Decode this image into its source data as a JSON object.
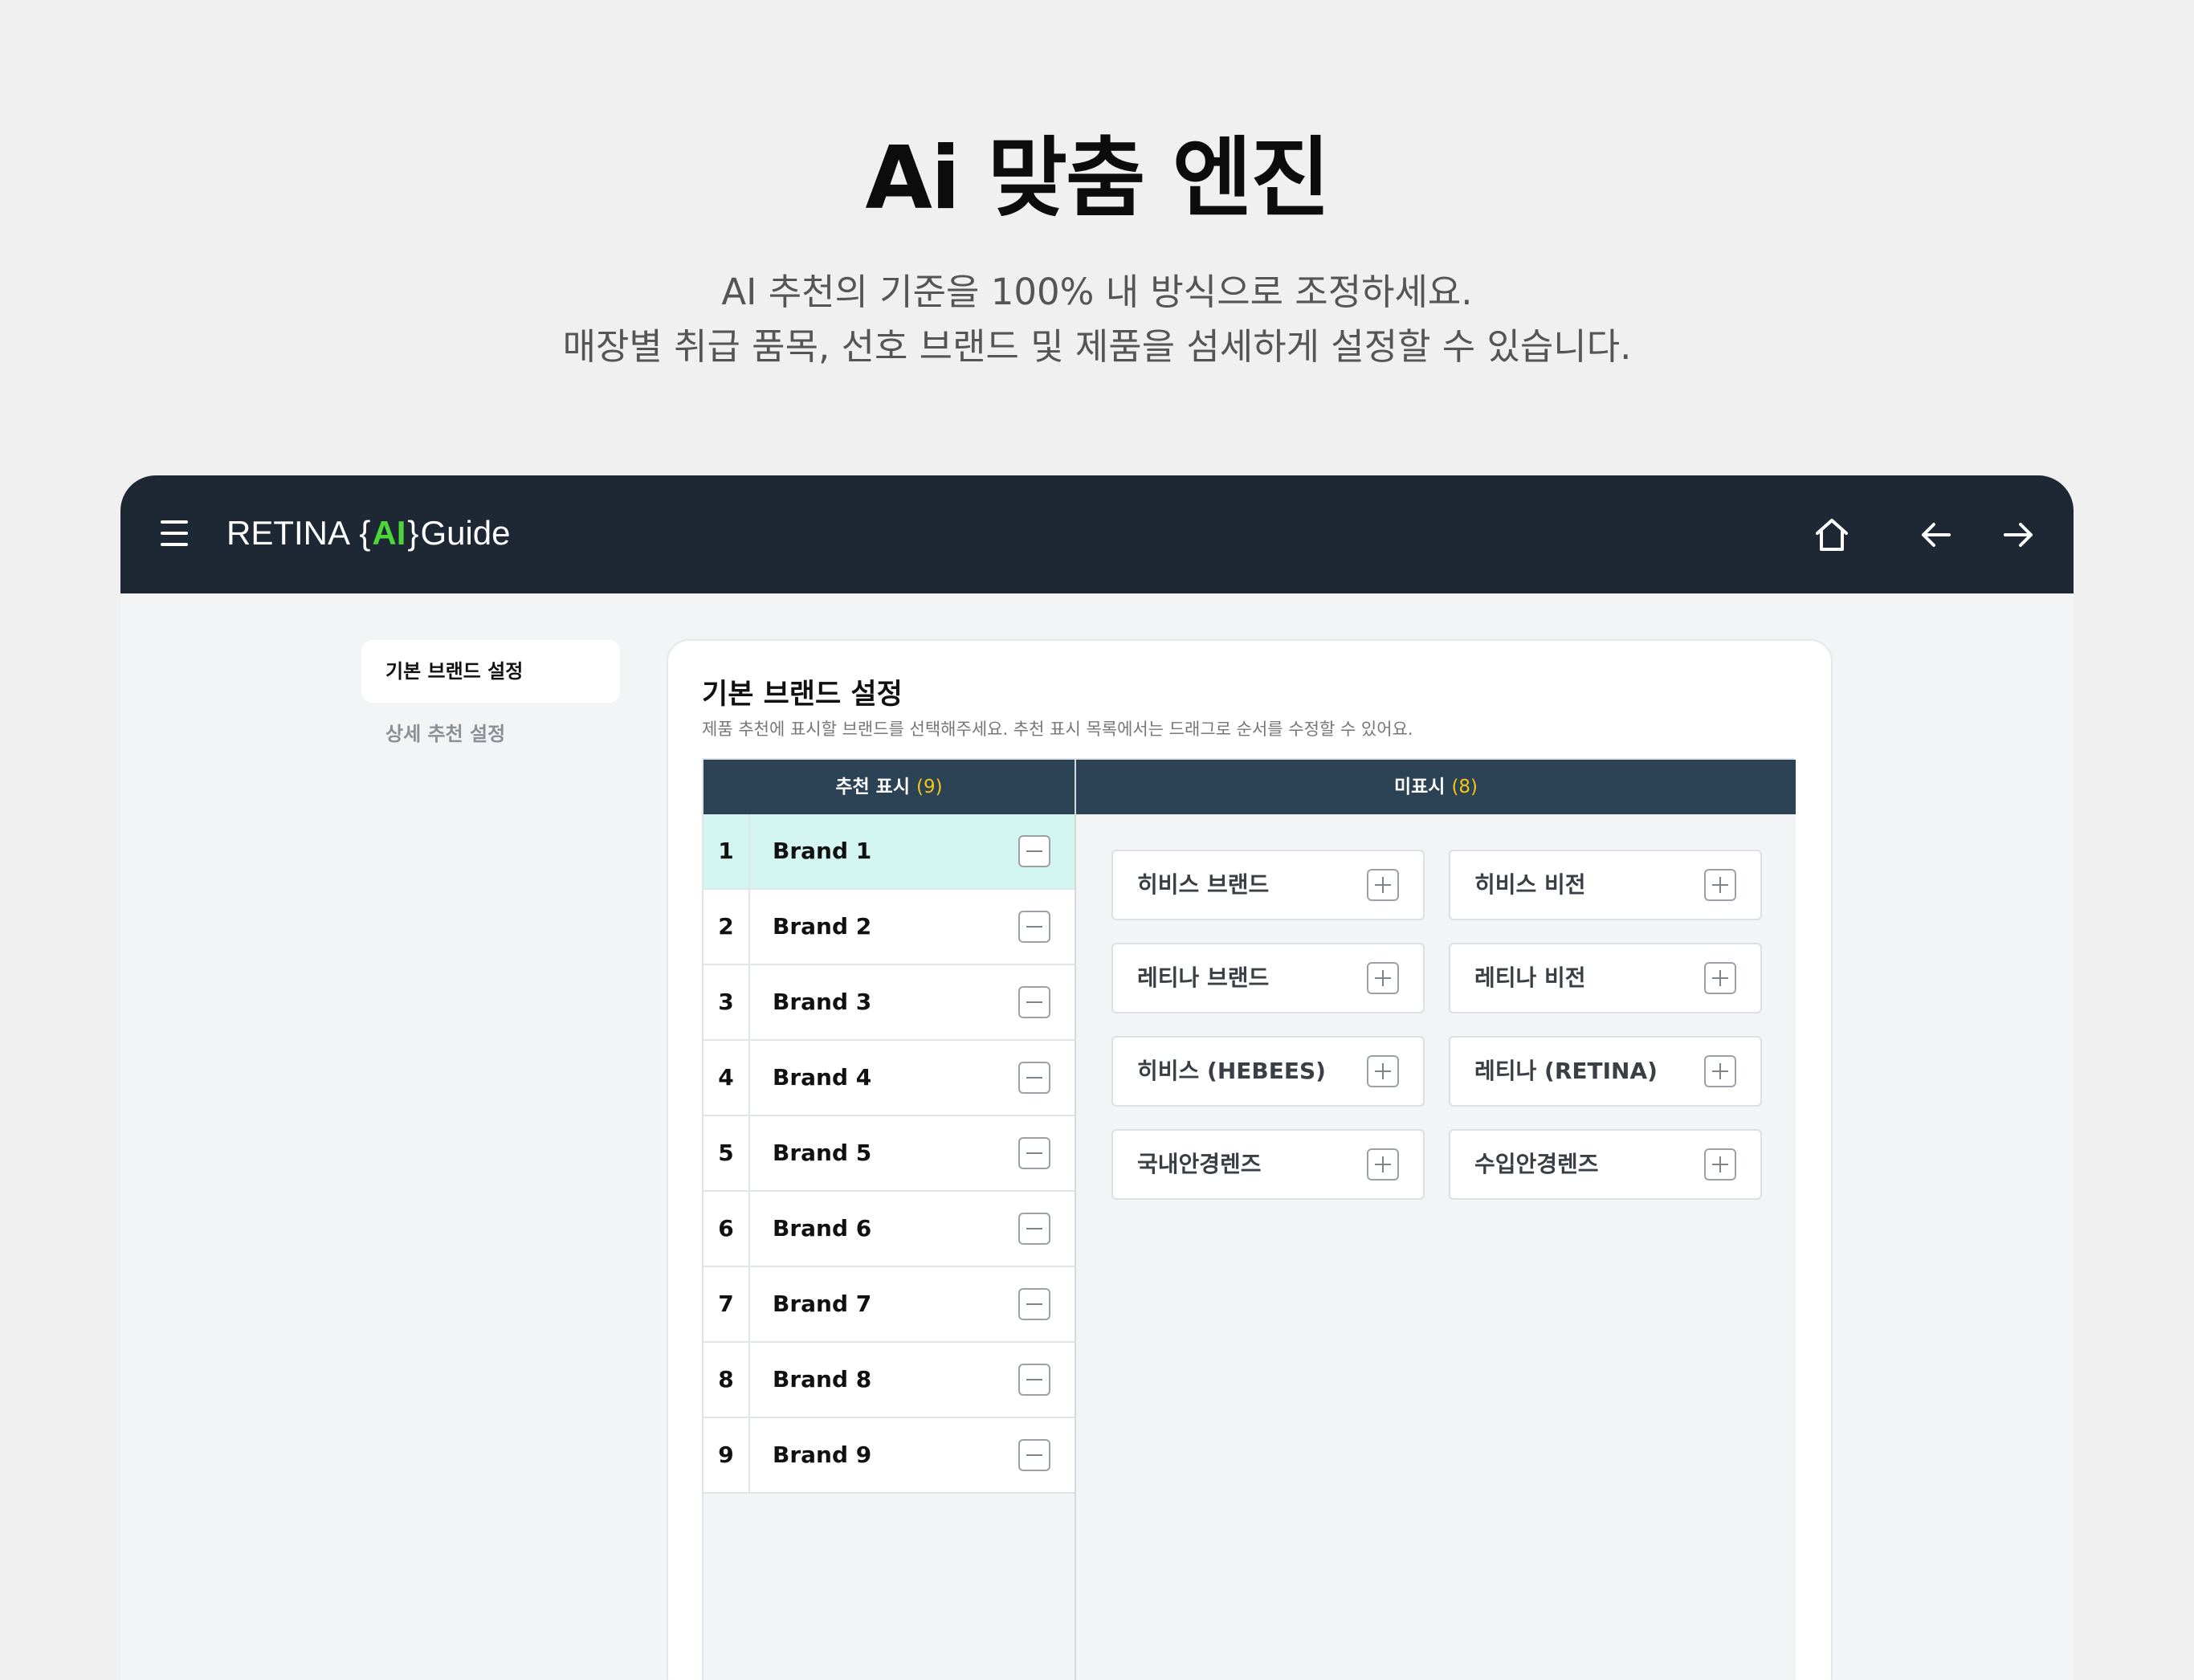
{
  "hero": {
    "title": "Ai 맞춤 엔진",
    "subtitle_line1": "AI 추천의 기준을 100% 내 방식으로 조정하세요.",
    "subtitle_line2": "매장별 취급 품목, 선호 브랜드 및 제품을 섬세하게 설정할 수 있습니다."
  },
  "app": {
    "logo_prefix": "RETINA",
    "logo_brace_open": "{",
    "logo_ai": "AI",
    "logo_brace_close": "}",
    "logo_suffix": "Guide",
    "colors": {
      "topbar": "#1d2834",
      "ai_accent": "#4cd63a",
      "header": "#2c4255",
      "count_accent": "#f5c518",
      "selected_row": "#d4f6f1"
    },
    "icons": [
      "menu-icon",
      "home-icon",
      "arrow-left-icon",
      "arrow-right-icon"
    ]
  },
  "sidebar": {
    "items": [
      {
        "label": "기본 브랜드 설정",
        "active": true
      },
      {
        "label": "상세 추천 설정",
        "active": false
      }
    ]
  },
  "panel": {
    "title": "기본 브랜드 설정",
    "description": "제품 추천에 표시할 브랜드를 선택해주세요. 추천 표시 목록에서는 드래그로 순서를 수정할 수 있어요.",
    "shown": {
      "header_label": "추천 표시",
      "count": "(9)",
      "items": [
        {
          "num": "1",
          "name": "Brand 1",
          "selected": true
        },
        {
          "num": "2",
          "name": "Brand 2"
        },
        {
          "num": "3",
          "name": "Brand 3"
        },
        {
          "num": "4",
          "name": "Brand 4"
        },
        {
          "num": "5",
          "name": "Brand 5"
        },
        {
          "num": "6",
          "name": "Brand 6"
        },
        {
          "num": "7",
          "name": "Brand 7"
        },
        {
          "num": "8",
          "name": "Brand 8"
        },
        {
          "num": "9",
          "name": "Brand 9"
        }
      ]
    },
    "hidden": {
      "header_label": "미표시",
      "count": "(8)",
      "items": [
        {
          "name": "히비스 브랜드"
        },
        {
          "name": "히비스 비전"
        },
        {
          "name": "레티나 브랜드"
        },
        {
          "name": "레티나 비전"
        },
        {
          "name": "히비스 (HEBEES)"
        },
        {
          "name": "레티나 (RETINA)"
        },
        {
          "name": "국내안경렌즈"
        },
        {
          "name": "수입안경렌즈"
        }
      ]
    }
  }
}
